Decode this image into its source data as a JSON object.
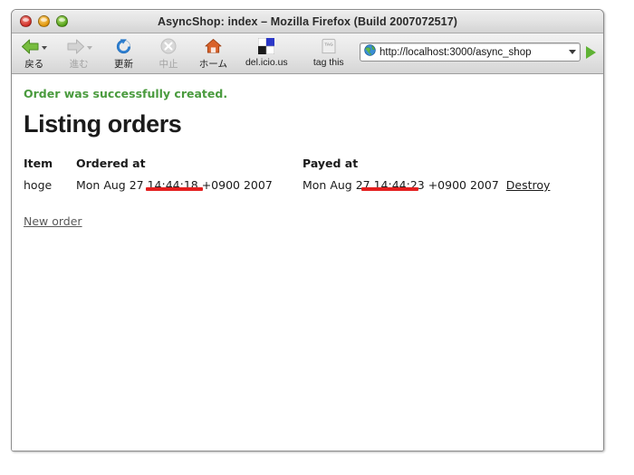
{
  "window": {
    "title": "AsyncShop: index – Mozilla Firefox (Build 2007072517)",
    "controls": {
      "close": "close-button",
      "minimize": "minimize-button",
      "zoom": "zoom-button"
    }
  },
  "toolbar": {
    "buttons": [
      {
        "label": "戻る",
        "icon": "back-arrow-icon",
        "enabled": true
      },
      {
        "label": "進む",
        "icon": "forward-arrow-icon",
        "enabled": false
      },
      {
        "label": "更新",
        "icon": "reload-icon",
        "enabled": true
      },
      {
        "label": "中止",
        "icon": "stop-icon",
        "enabled": false
      },
      {
        "label": "ホーム",
        "icon": "home-icon",
        "enabled": true
      },
      {
        "label": "del.icio.us",
        "icon": "delicious-icon",
        "enabled": true
      },
      {
        "label": "tag this",
        "icon": "tag-icon",
        "enabled": true
      }
    ],
    "tag_icon_text": "TAG"
  },
  "urlbar": {
    "favicon": "globe-icon",
    "url": "http://localhost:3000/async_shop",
    "dropdown": "chevron-down-icon",
    "go": "go-arrow-icon"
  },
  "page": {
    "flash_notice": "Order was successfully created.",
    "heading": "Listing orders",
    "table": {
      "headers": [
        "Item",
        "Ordered at",
        "Payed at",
        ""
      ],
      "rows": [
        {
          "item": "hoge",
          "ordered_at": "Mon Aug 27 14:44:18 +0900 2007",
          "payed_at": "Mon Aug 27 14:44:23 +0900 2007",
          "action": "Destroy"
        }
      ]
    },
    "new_order_link": "New order"
  },
  "annotations": {
    "color": "#e41f1f",
    "marks": [
      {
        "target": "ordered-at-time",
        "value": "14:44:18"
      },
      {
        "target": "payed-at-time",
        "value": "14:44:23"
      }
    ]
  }
}
